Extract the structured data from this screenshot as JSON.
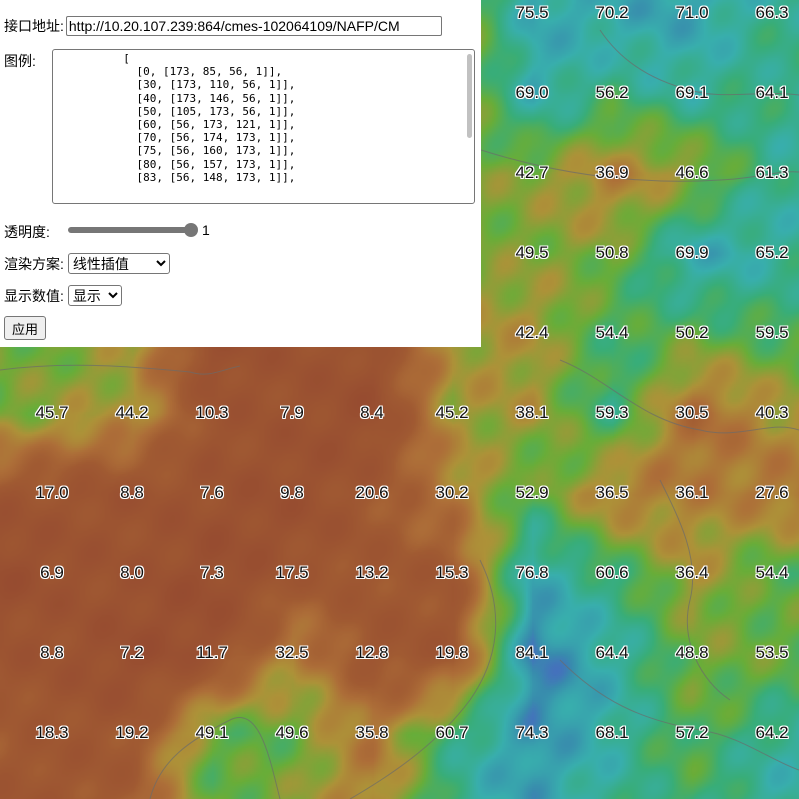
{
  "panel": {
    "url_label": "接口地址:",
    "url_value": "http://10.20.107.239:864/cmes-102064109/NAFP/CM",
    "legend_label": "图例:",
    "legend_text": "          [\n            [0, [173, 85, 56, 1]],\n            [30, [173, 110, 56, 1]],\n            [40, [173, 146, 56, 1]],\n            [50, [105, 173, 56, 1]],\n            [60, [56, 173, 121, 1]],\n            [70, [56, 174, 173, 1]],\n            [75, [56, 160, 173, 1]],\n            [80, [56, 157, 173, 1]],\n            [83, [56, 148, 173, 1]],",
    "opacity_label": "透明度:",
    "opacity_value": "1",
    "opacity_fraction": 1,
    "render_label": "渲染方案:",
    "render_selected": "线性插值",
    "display_label": "显示数值:",
    "display_selected": "显示",
    "apply_label": "应用"
  },
  "legend_colors": [
    {
      "v": 0,
      "c": "#ad5538"
    },
    {
      "v": 30,
      "c": "#ad6e38"
    },
    {
      "v": 40,
      "c": "#ad9238"
    },
    {
      "v": 50,
      "c": "#69ad38"
    },
    {
      "v": 60,
      "c": "#38ad79"
    },
    {
      "v": 70,
      "c": "#38aead"
    },
    {
      "v": 75,
      "c": "#38a0ad"
    },
    {
      "v": 80,
      "c": "#389dad"
    },
    {
      "v": 83,
      "c": "#3894ad"
    }
  ],
  "grid_values": [
    [
      null,
      null,
      null,
      null,
      null,
      null,
      "75.5",
      "70.2",
      "71.0",
      "66.3"
    ],
    [
      null,
      null,
      null,
      null,
      null,
      null,
      "69.0",
      "56.2",
      "69.1",
      "64.1"
    ],
    [
      null,
      null,
      null,
      null,
      null,
      null,
      "42.7",
      "36.9",
      "46.6",
      "61.3"
    ],
    [
      null,
      null,
      null,
      null,
      null,
      null,
      "49.5",
      "50.8",
      "69.9",
      "65.2"
    ],
    [
      null,
      null,
      null,
      null,
      null,
      null,
      "42.4",
      "54.4",
      "50.2",
      "59.5"
    ],
    [
      "45.7",
      "44.2",
      "10.3",
      "7.9",
      "8.4",
      "45.2",
      "38.1",
      "59.3",
      "30.5",
      "40.3"
    ],
    [
      "17.0",
      "8.8",
      "7.6",
      "9.8",
      "20.6",
      "30.2",
      "52.9",
      "36.5",
      "36.1",
      "27.6"
    ],
    [
      "6.9",
      "8.0",
      "7.3",
      "17.5",
      "13.2",
      "15.3",
      "76.8",
      "60.6",
      "36.4",
      "54.4"
    ],
    [
      "8.8",
      "7.2",
      "11.7",
      "32.5",
      "12.8",
      "19.8",
      "84.1",
      "64.4",
      "48.8",
      "53.5"
    ],
    [
      "18.3",
      "19.2",
      "49.1",
      "49.6",
      "35.8",
      "60.7",
      "74.3",
      "68.1",
      "57.2",
      "64.2"
    ]
  ]
}
